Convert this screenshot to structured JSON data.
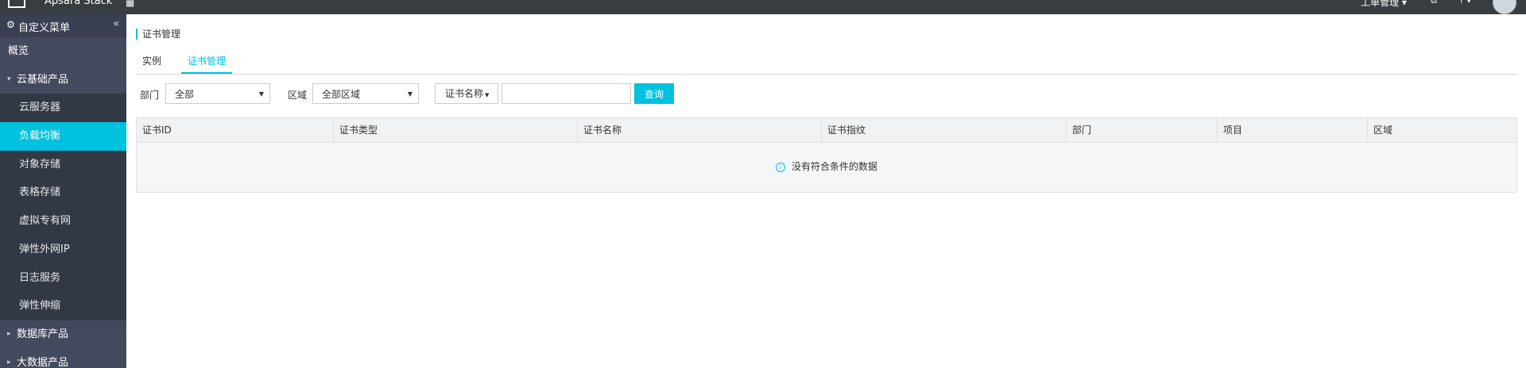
{
  "topbar": {
    "brand": "Apsara Stack",
    "ticket_menu": "工单管理 ▾",
    "doc_icon": "⧉",
    "help_icon": "? ▾"
  },
  "sidebar": {
    "header_label": "自定义菜单",
    "collapse_icon": "«",
    "overview": "概览",
    "groups": [
      {
        "label": "云基础产品",
        "expanded": true,
        "items": [
          {
            "label": "云服务器",
            "active": false
          },
          {
            "label": "负载均衡",
            "active": true
          },
          {
            "label": "对象存储",
            "active": false
          },
          {
            "label": "表格存储",
            "active": false
          },
          {
            "label": "虚拟专有网",
            "active": false
          },
          {
            "label": "弹性外网IP",
            "active": false
          },
          {
            "label": "日志服务",
            "active": false
          },
          {
            "label": "弹性伸缩",
            "active": false
          }
        ]
      },
      {
        "label": "数据库产品",
        "expanded": false
      },
      {
        "label": "大数据产品",
        "expanded": false
      }
    ]
  },
  "main": {
    "title": "证书管理",
    "tabs": [
      {
        "label": "实例",
        "active": false
      },
      {
        "label": "证书管理",
        "active": true
      }
    ],
    "filter": {
      "dept_label": "部门",
      "dept_value": "全部",
      "region_label": "区域",
      "region_value": "全部区域",
      "search_field": "证书名称",
      "search_value": "",
      "search_button": "查询"
    },
    "table": {
      "columns": [
        "证书ID",
        "证书类型",
        "证书名称",
        "证书指纹",
        "部门",
        "项目",
        "区域"
      ],
      "empty_text": "没有符合条件的数据"
    }
  },
  "colors": {
    "accent": "#00c1de",
    "sidebar_bg": "#3a3f51",
    "topbar_bg": "#373d41"
  }
}
